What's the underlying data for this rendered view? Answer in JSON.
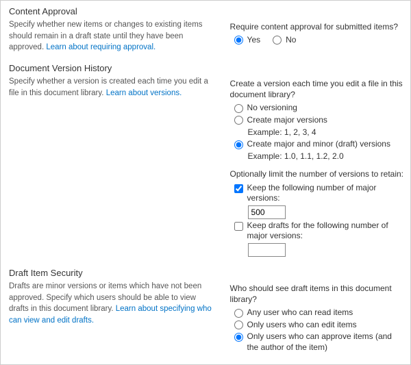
{
  "contentApproval": {
    "title": "Content Approval",
    "desc": "Specify whether new items or changes to existing items should remain in a draft state until they have been approved.  ",
    "learn": "Learn about requiring approval.",
    "question": "Require content approval for submitted items?",
    "yes": "Yes",
    "no": "No"
  },
  "versionHistory": {
    "title": "Document Version History",
    "desc": "Specify whether a version is created each time you edit a file in this document library. ",
    "learn": "Learn about versions.",
    "question": "Create a version each time you edit a file in this document library?",
    "optNone": "No versioning",
    "optMajor": "Create major versions",
    "exMajor": "Example: 1, 2, 3, 4",
    "optMajorMinor": "Create major and minor (draft) versions",
    "exMajorMinor": "Example: 1.0, 1.1, 1.2, 2.0",
    "limitQuestion": "Optionally limit the number of versions to retain:",
    "keepMajor": "Keep the following number of major versions:",
    "keepMajorValue": "500",
    "keepDrafts": "Keep drafts for the following number of major versions:",
    "keepDraftsValue": ""
  },
  "draftSecurity": {
    "title": "Draft Item Security",
    "desc": "Drafts are minor versions or items which have not been approved. Specify which users should be able to view drafts in this document library.  ",
    "learn": "Learn about specifying who can view and edit drafts.",
    "question": "Who should see draft items in this document library?",
    "optAny": "Any user who can read items",
    "optEdit": "Only users who can edit items",
    "optApprove": "Only users who can approve items (and the author of the item)"
  }
}
